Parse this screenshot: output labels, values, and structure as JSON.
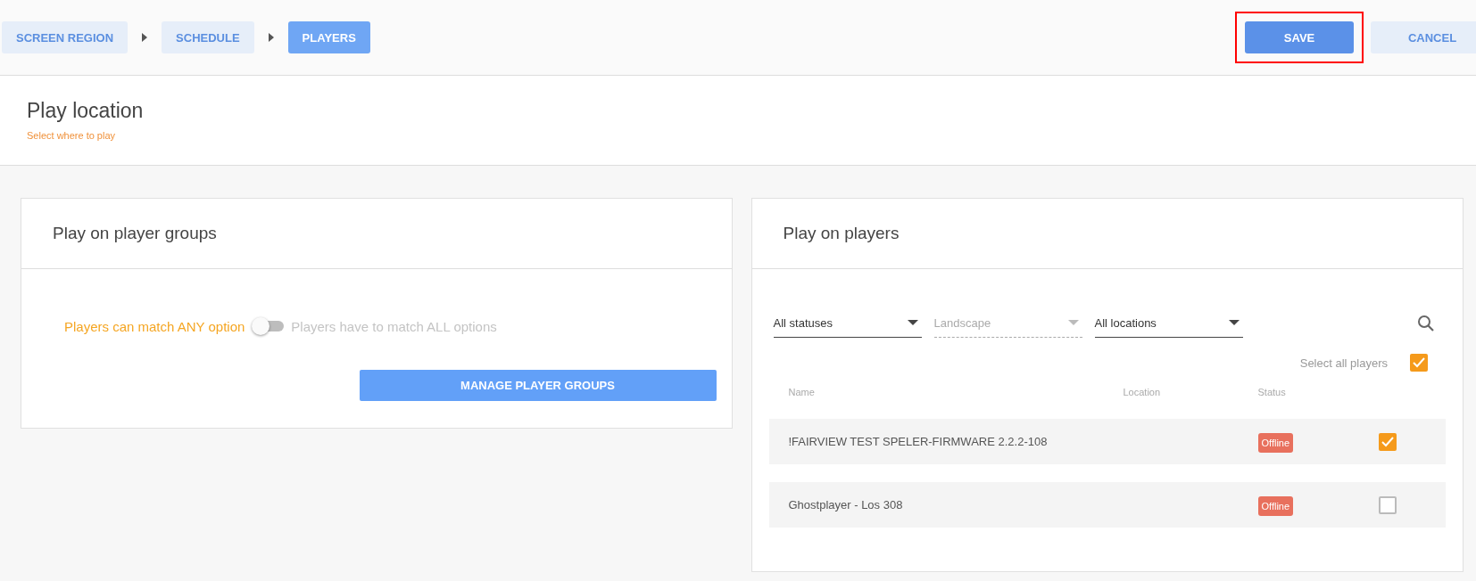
{
  "breadcrumb": [
    {
      "label": "SCREEN REGION",
      "selected": false
    },
    {
      "label": "SCHEDULE",
      "selected": false
    },
    {
      "label": "PLAYERS",
      "selected": true
    }
  ],
  "actions": {
    "save": {
      "label": "SAVE",
      "highlighted": true
    },
    "cancel": {
      "label": "CANCEL"
    }
  },
  "header": {
    "title": "Play location",
    "subtitle": "Select where to play"
  },
  "groups_card": {
    "title": "Play on player groups",
    "match_any_label": "Players can match ANY option",
    "match_all_label": "Players have to match ALL options",
    "match_all": {
      "on": false
    },
    "manage_button": "MANAGE PLAYER GROUPS"
  },
  "players_card": {
    "title": "Play on players",
    "filters": [
      {
        "value": "All statuses",
        "disabled": false
      },
      {
        "value": "Landscape",
        "disabled": true
      },
      {
        "value": "All locations",
        "disabled": false
      }
    ],
    "select_all": {
      "label": "Select all players",
      "checked": true
    },
    "columns": [
      "Name",
      "Location",
      "Status"
    ],
    "rows": [
      {
        "name": "!FAIRVIEW TEST SPELER-FIRMWARE 2.2.2-108",
        "status": "Offline",
        "checked": true
      },
      {
        "name": "Ghostplayer - Los 308",
        "status": "Offline",
        "checked": false
      }
    ]
  }
}
